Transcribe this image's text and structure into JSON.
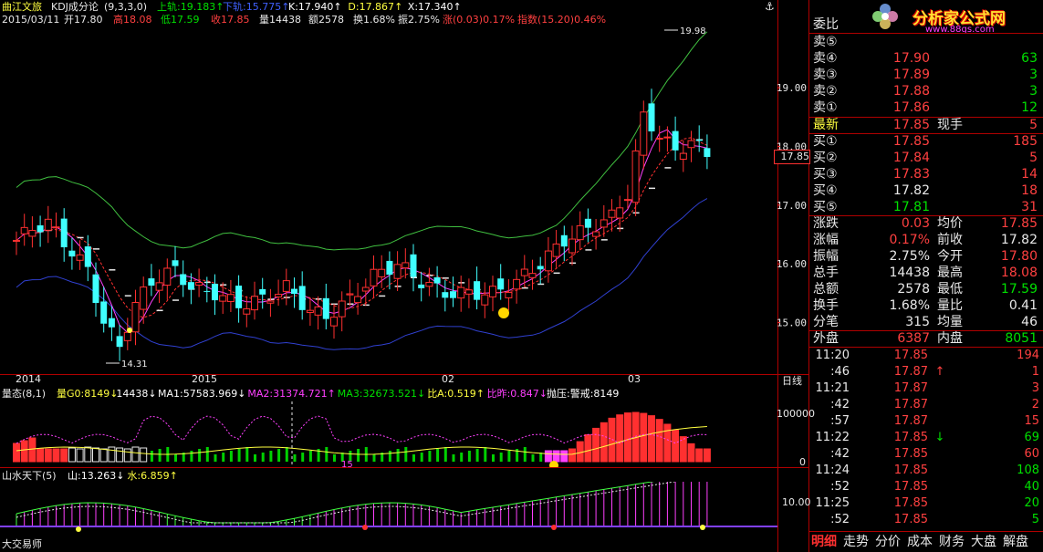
{
  "stock": {
    "title": "曲江文旅",
    "indicator": "KDJ成分论",
    "params": "(9,3,3,0)"
  },
  "main_legend": [
    {
      "label": "上轨:19.183",
      "arrow": "↑",
      "color": "#00e000"
    },
    {
      "label": "下轨:15.775",
      "arrow": "↑",
      "color": "#4060ff"
    },
    {
      "label": "K:17.940",
      "arrow": "↑",
      "color": "#ffffff"
    },
    {
      "label": "D:17.867",
      "arrow": "↑",
      "color": "#ffff40"
    },
    {
      "label": "X:17.340",
      "arrow": "↑",
      "color": "#ffffff"
    }
  ],
  "info_line": {
    "date": "2015/03/11",
    "open": "开17.80",
    "high": "高18.08",
    "low": "低17.59",
    "close": "收17.85",
    "volume": "量14438",
    "amount": "额2578",
    "turnover": "换1.68%",
    "amplitude": "振2.75%",
    "change": "涨(0.03)0.17%",
    "index": "指数(15.20)0.46%"
  },
  "price_labels": {
    "high_mark": "19.98",
    "low_mark": "14.31",
    "current": "17.85"
  },
  "y_axis": [
    "19.00",
    "18.00",
    "17.00",
    "16.00",
    "15.00"
  ],
  "x_axis": [
    "2014",
    "2015",
    "02",
    "03"
  ],
  "period_label": "日线",
  "vol_panel": {
    "title": "量态(8,1)",
    "items": [
      {
        "label": "量G0:8149",
        "arrow": "↓",
        "color": "#ffff40"
      },
      {
        "label": "14438",
        "arrow": "↓",
        "color": "#ffffff"
      },
      {
        "label": "MA1:57583.969",
        "arrow": "↓",
        "color": "#ffffff"
      },
      {
        "label": "MA2:31374.721",
        "arrow": "↑",
        "color": "#ff40ff"
      },
      {
        "label": "MA3:32673.521",
        "arrow": "↓",
        "color": "#00e000"
      },
      {
        "label": "比A:0.519",
        "arrow": "↑",
        "color": "#ffff40"
      },
      {
        "label": "比昨:0.847",
        "arrow": "↓",
        "color": "#ff40ff"
      },
      {
        "label": "抛压:警戒:8149",
        "arrow": "",
        "color": "#ffffff"
      }
    ],
    "y_axis": [
      "100000",
      "0"
    ],
    "mid_label": "15"
  },
  "osc_panel": {
    "title": "山水天下(5)",
    "items": [
      {
        "label": "山:13.263",
        "arrow": "↓",
        "color": "#ffffff"
      },
      {
        "label": "水:6.859",
        "arrow": "↑",
        "color": "#ffff40"
      }
    ],
    "y_axis": [
      "10.00"
    ],
    "footer": "大交易师"
  },
  "logo": {
    "name": "分析家公式网",
    "url": "www.88gs.com"
  },
  "quote": {
    "ratio_label": "委比",
    "asks": [
      {
        "label": "卖⑤",
        "price": "",
        "vol": ""
      },
      {
        "label": "卖④",
        "price": "17.90",
        "vol": "63"
      },
      {
        "label": "卖③",
        "price": "17.89",
        "vol": "3"
      },
      {
        "label": "卖②",
        "price": "17.88",
        "vol": "3"
      },
      {
        "label": "卖①",
        "price": "17.86",
        "vol": "12"
      }
    ],
    "last": {
      "label": "最新",
      "price": "17.85",
      "label2": "现手",
      "vol": "5"
    },
    "bids": [
      {
        "label": "买①",
        "price": "17.85",
        "vol": "185"
      },
      {
        "label": "买②",
        "price": "17.84",
        "vol": "5"
      },
      {
        "label": "买③",
        "price": "17.83",
        "vol": "14"
      },
      {
        "label": "买④",
        "price": "17.82",
        "vol": "18"
      },
      {
        "label": "买⑤",
        "price": "17.81",
        "vol": "31"
      }
    ],
    "stats": [
      {
        "l": "涨跌",
        "v": "0.03",
        "vc": "#ff4040",
        "l2": "均价",
        "v2": "17.85",
        "v2c": "#ff4040"
      },
      {
        "l": "涨幅",
        "v": "0.17%",
        "vc": "#ff4040",
        "l2": "前收",
        "v2": "17.82",
        "v2c": "#e8e8e8"
      },
      {
        "l": "振幅",
        "v": "2.75%",
        "vc": "#e8e8e8",
        "l2": "今开",
        "v2": "17.80",
        "v2c": "#ff4040"
      },
      {
        "l": "总手",
        "v": "14438",
        "vc": "#e8e8e8",
        "l2": "最高",
        "v2": "18.08",
        "v2c": "#ff4040"
      },
      {
        "l": "总额",
        "v": "2578",
        "vc": "#e8e8e8",
        "l2": "最低",
        "v2": "17.59",
        "v2c": "#00e000"
      },
      {
        "l": "换手",
        "v": "1.68%",
        "vc": "#e8e8e8",
        "l2": "量比",
        "v2": "0.41",
        "v2c": "#e8e8e8"
      },
      {
        "l": "分笔",
        "v": "315",
        "vc": "#e8e8e8",
        "l2": "均量",
        "v2": "46",
        "v2c": "#e8e8e8"
      }
    ],
    "outer": {
      "label": "外盘",
      "value": "6387",
      "label2": "内盘",
      "value2": "8051"
    }
  },
  "ticks": [
    {
      "time": "11:20",
      "price": "17.85",
      "arrow": "",
      "vol": "194",
      "color": "#ff4040"
    },
    {
      "time": ":46",
      "price": "17.87",
      "arrow": "↑",
      "vol": "1",
      "color": "#ff4040"
    },
    {
      "time": "11:21",
      "price": "17.87",
      "arrow": "",
      "vol": "3",
      "color": "#ff4040"
    },
    {
      "time": ":42",
      "price": "17.87",
      "arrow": "",
      "vol": "2",
      "color": "#ff4040"
    },
    {
      "time": ":57",
      "price": "17.87",
      "arrow": "",
      "vol": "15",
      "color": "#ff4040"
    },
    {
      "time": "11:22",
      "price": "17.85",
      "arrow": "↓",
      "vol": "69",
      "color": "#00e000"
    },
    {
      "time": ":42",
      "price": "17.85",
      "arrow": "",
      "vol": "60",
      "color": "#ff4040"
    },
    {
      "time": "11:24",
      "price": "17.85",
      "arrow": "",
      "vol": "108",
      "color": "#00e000"
    },
    {
      "time": ":52",
      "price": "17.85",
      "arrow": "",
      "vol": "40",
      "color": "#00e000"
    },
    {
      "time": "11:25",
      "price": "17.85",
      "arrow": "",
      "vol": "20",
      "color": "#00e000"
    },
    {
      "time": ":52",
      "price": "17.85",
      "arrow": "",
      "vol": "5",
      "color": "#00e000"
    }
  ],
  "bottom_tabs": [
    "明细",
    "走势",
    "分价",
    "成本",
    "财务",
    "大盘",
    "解盘"
  ],
  "colors": {
    "up": "#ff3030",
    "down": "#40ffff",
    "grid": "#b00000",
    "upper_band": "#40c040",
    "lower_band": "#3040d0"
  }
}
